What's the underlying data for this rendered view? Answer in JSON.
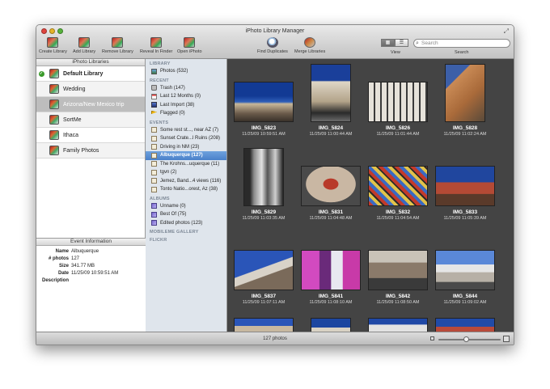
{
  "window": {
    "title": "iPhoto Library Manager"
  },
  "toolbar": {
    "create_library": "Create Library",
    "add_library": "Add Library",
    "remove_library": "Remove Library",
    "reveal_in_finder": "Reveal In Finder",
    "open_iphoto": "Open iPhoto",
    "find_duplicates": "Find Duplicates",
    "merge_libraries": "Merge Libraries",
    "view_label": "View",
    "view_mode": "grid",
    "search_placeholder": "Search",
    "search_label": "Search"
  },
  "libraries": {
    "header": "iPhoto Libraries",
    "items": [
      {
        "label": "Default Library",
        "default": true
      },
      {
        "label": "Wedding"
      },
      {
        "label": "Arizona/New Mexico trip",
        "selected": true
      },
      {
        "label": "SortMe"
      },
      {
        "label": "Ithaca"
      },
      {
        "label": "Family Photos"
      }
    ]
  },
  "event_info": {
    "header": "Event Information",
    "name_label": "Name",
    "name": "Albuquerque",
    "photos_label": "# photos",
    "photos": "127",
    "size_label": "Size",
    "size": "341.77 MB",
    "date_label": "Date",
    "date": "11/25/09 10:59:51 AM",
    "description_label": "Description",
    "description": ""
  },
  "source_list": {
    "library_header": "LIBRARY",
    "photos": "Photos (532)",
    "recent_header": "RECENT",
    "recent": [
      "Trash (147)",
      "Last 12 Months (0)",
      "Last Import (38)",
      "Flagged (0)"
    ],
    "events_header": "EVENTS",
    "events": [
      "Some rest st..., near AZ (7)",
      "Sunset Crate...l Ruins (208)",
      "Driving in NM (23)",
      "Albuquerque (127)",
      "The Krohns...uquerque (11)",
      "tgvn (2)",
      "Jemez, Band...4 views (116)",
      "Tonto Natio...orest, Az (38)"
    ],
    "selected_event": 3,
    "albums_header": "ALBUMS",
    "albums": [
      "Unname (0)",
      "Best Of (75)",
      "Edited photos (123)"
    ],
    "mobileme_header": "MOBILEME GALLERY",
    "flickr_header": "FLICKR"
  },
  "photos": [
    {
      "name": "IMG_5823",
      "date": "11/25/09 10:59:51 AM"
    },
    {
      "name": "IMG_5824",
      "date": "11/25/09 11:00:44 AM"
    },
    {
      "name": "IMG_5826",
      "date": "11/25/09 11:01:44 AM"
    },
    {
      "name": "IMG_5828",
      "date": "11/25/09 11:02:24 AM"
    },
    {
      "name": "IMG_5829",
      "date": "11/25/09 11:03:35 AM"
    },
    {
      "name": "IMG_5831",
      "date": "11/25/09 11:04:48 AM"
    },
    {
      "name": "IMG_5832",
      "date": "11/25/09 11:04:54 AM"
    },
    {
      "name": "IMG_5833",
      "date": "11/25/09 11:05:39 AM"
    },
    {
      "name": "IMG_5837",
      "date": "11/25/09 11:07:11 AM"
    },
    {
      "name": "IMG_5841",
      "date": "11/25/09 11:08:10 AM"
    },
    {
      "name": "IMG_5842",
      "date": "11/25/09 11:08:50 AM"
    },
    {
      "name": "IMG_5844",
      "date": "11/25/09 11:09:02 AM"
    }
  ],
  "status": {
    "count": "127 photos",
    "zoom_level": 0.45
  }
}
